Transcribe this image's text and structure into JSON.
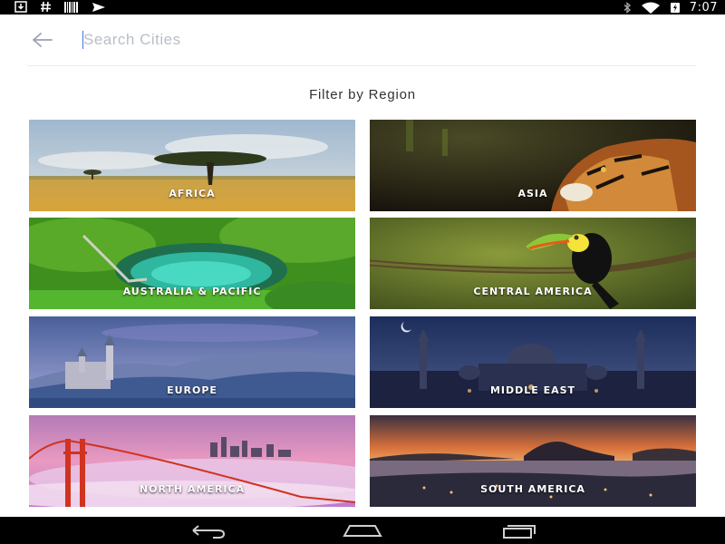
{
  "status_bar": {
    "time": "7:07",
    "left_icons": [
      "download-icon",
      "hash-icon",
      "barcode-icon",
      "send-icon"
    ],
    "right_icons": [
      "bluetooth-icon",
      "wifi-icon",
      "battery-icon"
    ]
  },
  "search": {
    "placeholder": "Search Cities",
    "value": ""
  },
  "filter_title": "Filter by Region",
  "regions": [
    {
      "label": "AFRICA"
    },
    {
      "label": "ASIA"
    },
    {
      "label": "AUSTRALIA & PACIFIC"
    },
    {
      "label": "CENTRAL AMERICA"
    },
    {
      "label": "EUROPE"
    },
    {
      "label": "MIDDLE EAST"
    },
    {
      "label": "NORTH AMERICA"
    },
    {
      "label": "SOUTH AMERICA"
    }
  ],
  "nav": {
    "icons": [
      "back-icon",
      "home-icon",
      "recents-icon"
    ]
  }
}
